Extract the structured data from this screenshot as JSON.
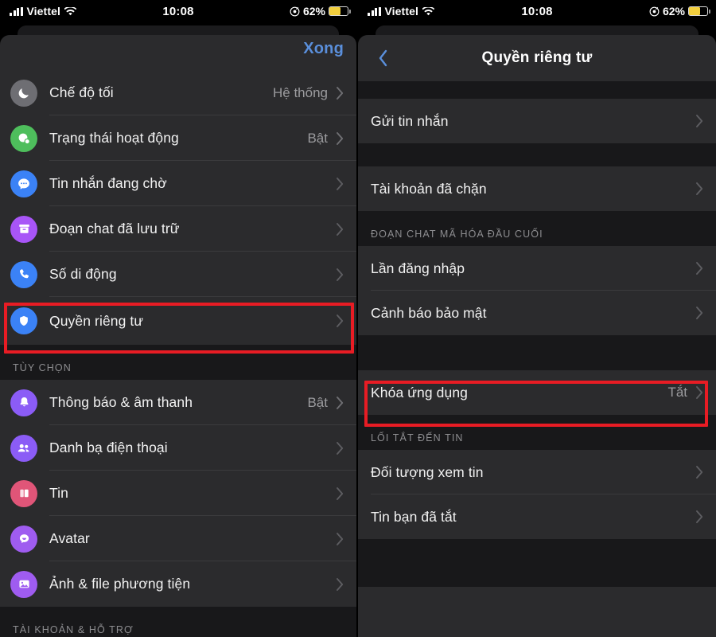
{
  "status_bar": {
    "carrier": "Viettel",
    "time": "10:08",
    "battery_percent": "62%",
    "wifi_icon": "wifi-icon",
    "signal_icon": "cellular-signal-icon",
    "lowpower_icon": "low-power-mode-icon",
    "battery_icon": "battery-icon",
    "battery_fill_color": "#f2cf3e",
    "battery_level": 62
  },
  "left_screen": {
    "done_label": "Xong",
    "accent_color": "#5a8fdb",
    "rows": [
      {
        "label": "Chế độ tối",
        "value": "Hệ thống",
        "icon": "moon-icon",
        "icon_color": "#6e6e73"
      },
      {
        "label": "Trạng thái hoạt động",
        "value": "Bật",
        "icon": "active-status-icon",
        "icon_color": "#4ebe5c"
      },
      {
        "label": "Tin nhắn đang chờ",
        "value": "",
        "icon": "chat-bubble-icon",
        "icon_color": "#3b82f6"
      },
      {
        "label": "Đoạn chat đã lưu trữ",
        "value": "",
        "icon": "archive-icon",
        "icon_color": "#a855f7"
      },
      {
        "label": "Số di động",
        "value": "",
        "icon": "phone-icon",
        "icon_color": "#3b82f6"
      },
      {
        "label": "Quyền riêng tư",
        "value": "",
        "icon": "shield-icon",
        "icon_color": "#3b82f6"
      }
    ],
    "options_section_title": "TÙY CHỌN",
    "options_rows": [
      {
        "label": "Thông báo & âm thanh",
        "value": "Bật",
        "icon": "bell-icon",
        "icon_color": "#8b5cf6"
      },
      {
        "label": "Danh bạ điện thoại",
        "value": "",
        "icon": "contacts-icon",
        "icon_color": "#8b5cf6"
      },
      {
        "label": "Tin",
        "value": "",
        "icon": "stories-icon",
        "icon_color": "#e05578"
      },
      {
        "label": "Avatar",
        "value": "",
        "icon": "avatar-icon",
        "icon_color": "#9f5cf0"
      },
      {
        "label": "Ảnh & file phương tiện",
        "value": "",
        "icon": "photos-icon",
        "icon_color": "#9f5cf0"
      }
    ],
    "account_section_title": "TÀI KHOẢN & HỖ TRỢ",
    "highlight_row_label": "Quyền riêng tư"
  },
  "right_screen": {
    "title": "Quyền riêng tư",
    "back_icon": "chevron-left-icon",
    "accent_color": "#5a8fdb",
    "group1": [
      {
        "label": "Gửi tin nhắn",
        "value": ""
      }
    ],
    "group2": [
      {
        "label": "Tài khoản đã chặn",
        "value": ""
      }
    ],
    "encrypted_section_title": "ĐOẠN CHAT MÃ HÓA ĐẦU CUỐI",
    "encrypted_rows": [
      {
        "label": "Lần đăng nhập",
        "value": ""
      },
      {
        "label": "Cảnh báo bảo mật",
        "value": ""
      }
    ],
    "applock_row": {
      "label": "Khóa ứng dụng",
      "value": "Tắt"
    },
    "stories_section_title": "LỐI TẮT ĐẾN TIN",
    "stories_rows": [
      {
        "label": "Đối tượng xem tin",
        "value": ""
      },
      {
        "label": "Tin bạn đã tắt",
        "value": ""
      }
    ],
    "highlight_row_label": "Khóa ứng dụng"
  },
  "annotation": {
    "highlight_color": "#e81c24"
  }
}
